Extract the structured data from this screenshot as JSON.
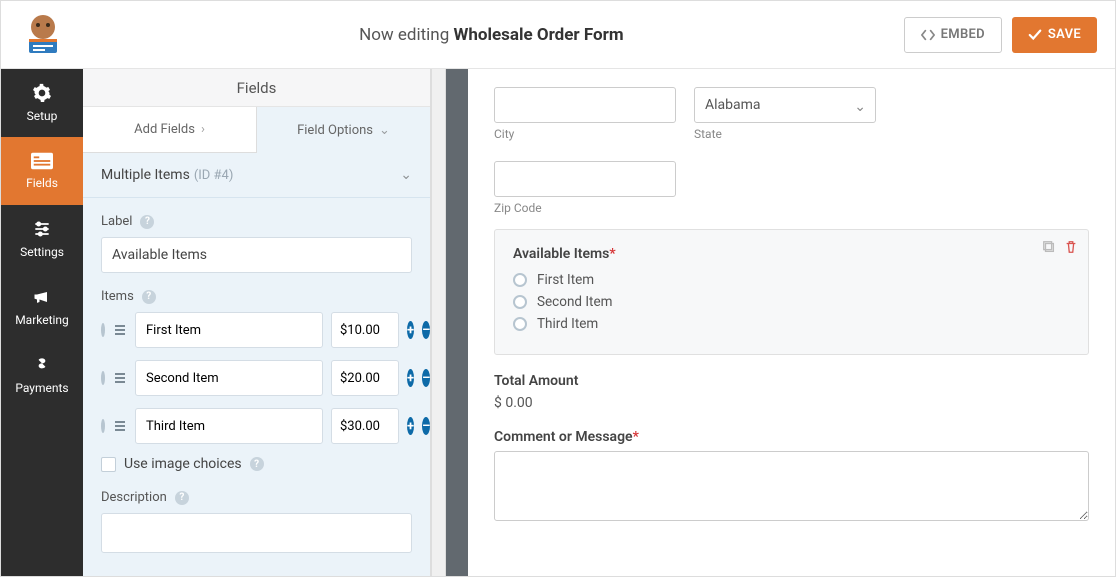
{
  "header": {
    "editing_prefix": "Now editing ",
    "form_name": "Wholesale Order Form",
    "embed": "EMBED",
    "save": "SAVE"
  },
  "sidenav": [
    {
      "key": "setup",
      "label": "Setup"
    },
    {
      "key": "fields",
      "label": "Fields"
    },
    {
      "key": "settings",
      "label": "Settings"
    },
    {
      "key": "marketing",
      "label": "Marketing"
    },
    {
      "key": "payments",
      "label": "Payments"
    }
  ],
  "subheader": "Fields",
  "tabs": {
    "add": "Add Fields",
    "options": "Field Options"
  },
  "options_panel": {
    "group_title": "Multiple Items",
    "group_id": "(ID #4)",
    "label_heading": "Label",
    "label_value": "Available Items",
    "items_heading": "Items",
    "items": [
      {
        "name": "First Item",
        "price": "$10.00"
      },
      {
        "name": "Second Item",
        "price": "$20.00"
      },
      {
        "name": "Third Item",
        "price": "$30.00"
      }
    ],
    "use_image_choices": "Use image choices",
    "description_heading": "Description"
  },
  "preview": {
    "city_label": "City",
    "state_label": "State",
    "state_value": "Alabama",
    "zip_label": "Zip Code",
    "available_title": "Available Items",
    "options": [
      "First Item",
      "Second Item",
      "Third Item"
    ],
    "total_label": "Total Amount",
    "total_value": "$ 0.00",
    "comment_label": "Comment or Message"
  },
  "colors": {
    "accent": "#e27730"
  }
}
